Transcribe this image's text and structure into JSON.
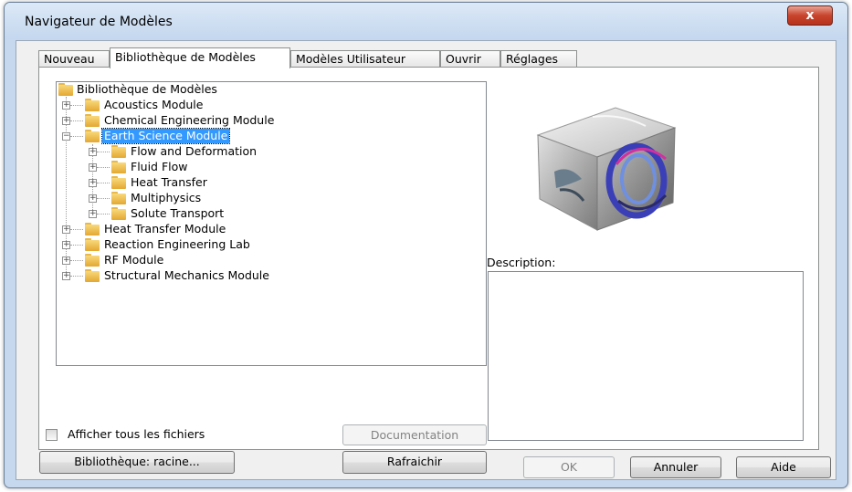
{
  "window": {
    "title": "Navigateur de Modèles",
    "close_label": "x"
  },
  "tabs": [
    {
      "label": "Nouveau",
      "active": false
    },
    {
      "label": "Bibliothèque de Modèles",
      "active": true
    },
    {
      "label": "Modèles Utilisateur",
      "active": false
    },
    {
      "label": "Ouvrir",
      "active": false
    },
    {
      "label": "Réglages",
      "active": false
    }
  ],
  "tree": {
    "root": "Bibliothèque de Modèles",
    "items": [
      {
        "label": "Acoustics Module",
        "expander": "+"
      },
      {
        "label": "Chemical Engineering Module",
        "expander": "+"
      },
      {
        "label": "Earth Science Module",
        "expander": "−",
        "selected": true
      },
      {
        "label": "Flow and Deformation",
        "expander": "+"
      },
      {
        "label": "Fluid Flow",
        "expander": "+"
      },
      {
        "label": "Heat Transfer",
        "expander": "+"
      },
      {
        "label": "Multiphysics",
        "expander": "+"
      },
      {
        "label": "Solute Transport",
        "expander": "+"
      },
      {
        "label": "Heat Transfer Module",
        "expander": "+"
      },
      {
        "label": "Reaction Engineering Lab",
        "expander": "+"
      },
      {
        "label": "RF Module",
        "expander": "+"
      },
      {
        "label": "Structural Mechanics Module",
        "expander": "+"
      }
    ]
  },
  "description": {
    "label": "Description:",
    "value": ""
  },
  "options": {
    "show_all_files_label": "Afficher tous les fichiers",
    "show_all_files_checked": false
  },
  "buttons": {
    "library_root": "Bibliothèque: racine...",
    "documentation": "Documentation",
    "refresh": "Rafraichir",
    "ok": "OK",
    "cancel": "Annuler",
    "help": "Aide"
  },
  "colors": {
    "selection": "#3399ff",
    "title_bar": "#c5d8ee",
    "close_button": "#c8442c"
  }
}
